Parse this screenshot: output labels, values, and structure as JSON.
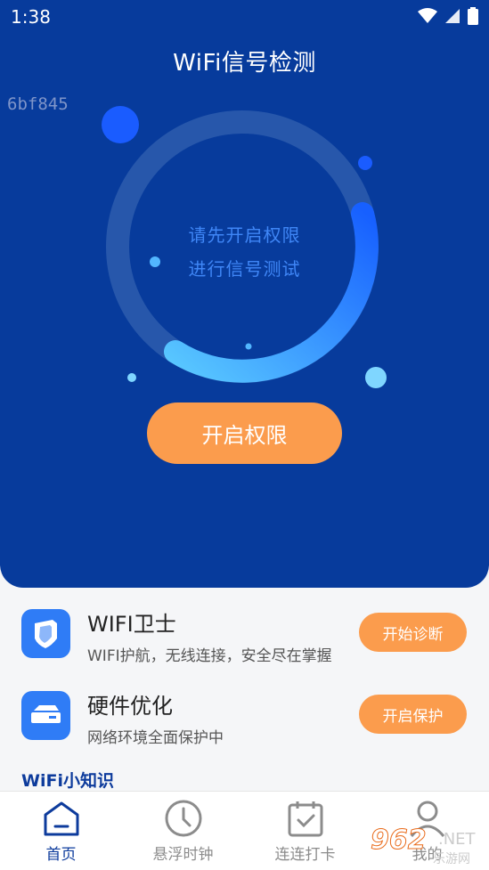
{
  "status_bar": {
    "time": "1:38"
  },
  "header": {
    "title": "WiFi信号检测",
    "code": "6bf845"
  },
  "ring": {
    "line1": "请先开启权限",
    "line2": "进行信号测试"
  },
  "primary_button": {
    "label": "开启权限"
  },
  "features": [
    {
      "name": "WIFI卫士",
      "desc": "WIFI护航，无线连接，安全尽在掌握",
      "action": "开始诊断",
      "icon": "shield-icon"
    },
    {
      "name": "硬件优化",
      "desc": "网络环境全面保护中",
      "action": "开启保护",
      "icon": "hardware-icon"
    }
  ],
  "section": {
    "title": "WiFi小知识"
  },
  "tabbar": [
    {
      "label": "首页",
      "icon": "home-icon",
      "active": true
    },
    {
      "label": "悬浮时钟",
      "icon": "clock-icon",
      "active": false
    },
    {
      "label": "连连打卡",
      "icon": "calendar-check-icon",
      "active": false
    },
    {
      "label": "我的",
      "icon": "profile-icon",
      "active": false
    }
  ],
  "watermark": {
    "number": "962",
    "net": ".NET",
    "sub": "乐游网"
  },
  "colors": {
    "hero_bg": "#073b9c",
    "accent_orange": "#fb9c4d",
    "icon_blue": "#2f7cf6"
  }
}
